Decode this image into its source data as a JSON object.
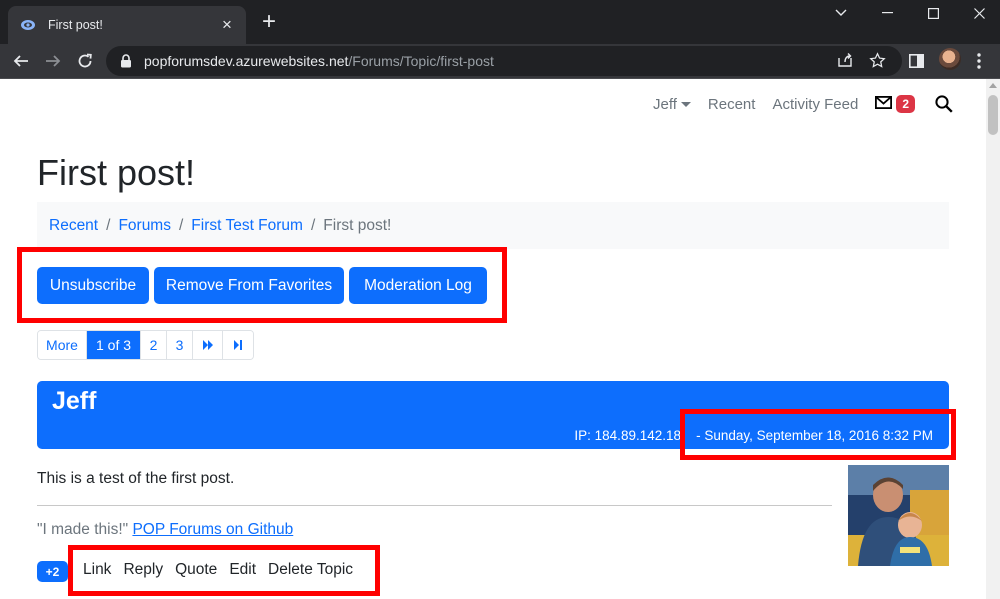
{
  "browser": {
    "tab_title": "First post!",
    "url_host": "popforumsdev.azurewebsites.net",
    "url_path": "/Forums/Topic/first-post"
  },
  "nav": {
    "user": "Jeff",
    "recent": "Recent",
    "activity_feed": "Activity Feed",
    "mail_count": "2"
  },
  "page_title": "First post!",
  "breadcrumb": {
    "recent": "Recent",
    "forums": "Forums",
    "forum": "First Test Forum",
    "current": "First post!",
    "separator": "/"
  },
  "actions": {
    "unsubscribe": "Unsubscribe",
    "remove_favorites": "Remove From Favorites",
    "moderation_log": "Moderation Log"
  },
  "pager": {
    "more": "More",
    "current": "1 of 3",
    "page2": "2",
    "page3": "3"
  },
  "post": {
    "author": "Jeff",
    "ip": "IP: 184.89.142.18",
    "date": "- Sunday, September 18, 2016 8:32 PM",
    "body": "This is a test of the first post.",
    "signature_quote": "\"I made this!\"",
    "signature_link": "POP Forums on Github",
    "vote_count": "+2",
    "links": {
      "link": "Link",
      "reply": "Reply",
      "quote": "Quote",
      "edit": "Edit",
      "delete": "Delete Topic"
    }
  },
  "colors": {
    "primary": "#0d6efd",
    "danger_badge": "#dc3545",
    "highlight_box": "#ff0000"
  }
}
